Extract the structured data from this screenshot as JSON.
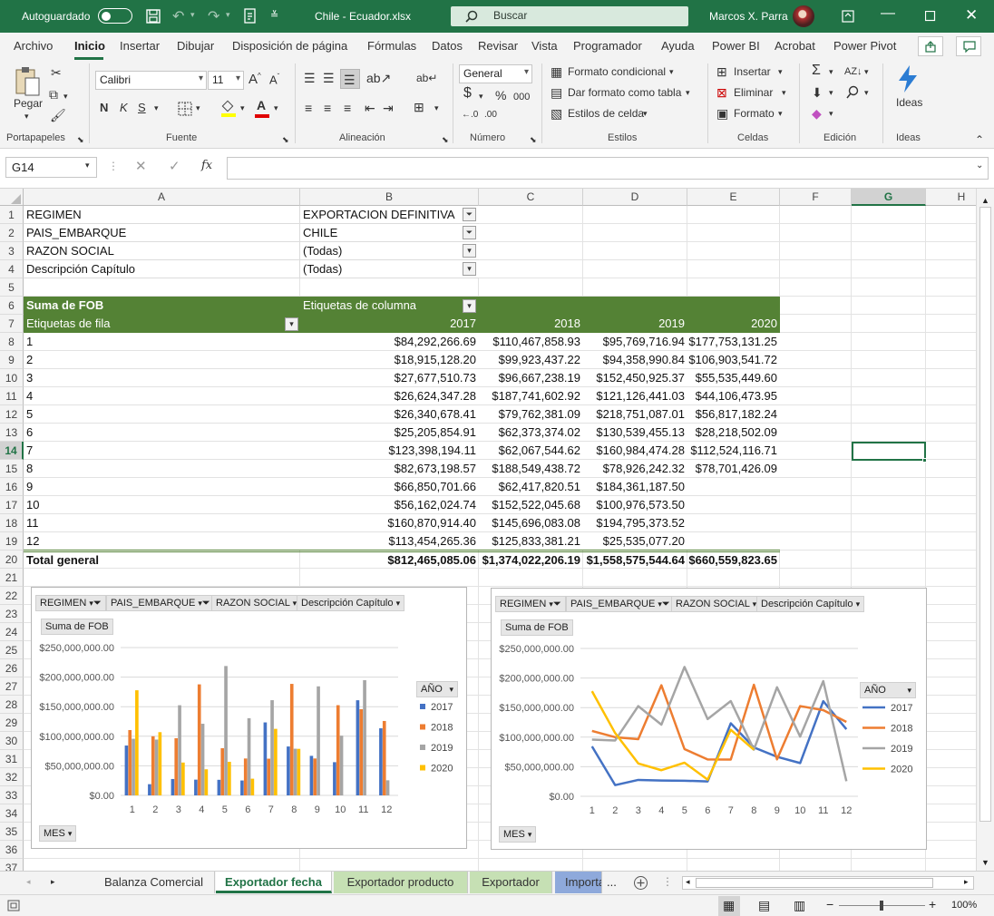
{
  "titlebar": {
    "autosave_label": "Autoguardado",
    "file_title": "Chile - Ecuador.xlsx",
    "search_placeholder": "Buscar",
    "user_name": "Marcos X. Parra"
  },
  "menu": [
    "Archivo",
    "Inicio",
    "Insertar",
    "Dibujar",
    "Disposición de página",
    "Fórmulas",
    "Datos",
    "Revisar",
    "Vista",
    "Programador",
    "Ayuda",
    "Power BI",
    "Acrobat",
    "Power Pivot"
  ],
  "ribbon": {
    "paste_label": "Pegar",
    "font_name": "Calibri",
    "font_size": "11",
    "number_format": "General",
    "conditional_format": "Formato condicional",
    "table_format": "Dar formato como tabla",
    "cell_styles": "Estilos de celda",
    "insert": "Insertar",
    "delete": "Eliminar",
    "format": "Formato",
    "ideas": "Ideas",
    "groups": [
      "Portapapeles",
      "Fuente",
      "Alineación",
      "Número",
      "Estilos",
      "Celdas",
      "Edición",
      "Ideas"
    ]
  },
  "formula_bar": {
    "name_box": "G14",
    "formula": ""
  },
  "columns": [
    "A",
    "B",
    "C",
    "D",
    "E",
    "F",
    "G",
    "H"
  ],
  "rows": [
    "1",
    "2",
    "3",
    "4",
    "5",
    "6",
    "7",
    "8",
    "9",
    "10",
    "11",
    "12",
    "13",
    "14",
    "15",
    "16",
    "17",
    "18",
    "19",
    "20",
    "21",
    "22",
    "23",
    "24",
    "25",
    "26",
    "27",
    "28",
    "29",
    "30",
    "31",
    "32",
    "33",
    "34",
    "35",
    "36",
    "37"
  ],
  "filters": [
    {
      "label": "REGIMEN",
      "value": "EXPORTACION DEFINITIVA"
    },
    {
      "label": "PAIS_EMBARQUE",
      "value": "CHILE"
    },
    {
      "label": "RAZON SOCIAL",
      "value": "(Todas)"
    },
    {
      "label": "Descripción Capítulo",
      "value": "(Todas)"
    }
  ],
  "pivot": {
    "value_header": "Suma de FOB",
    "col_labels": "Etiquetas de columna",
    "row_labels": "Etiquetas de fila",
    "years": [
      "2017",
      "2018",
      "2019",
      "2020"
    ],
    "rows": [
      {
        "label": "1",
        "values": [
          "$84,292,266.69",
          "$110,467,858.93",
          "$95,769,716.94",
          "$177,753,131.25"
        ]
      },
      {
        "label": "2",
        "values": [
          "$18,915,128.20",
          "$99,923,437.22",
          "$94,358,990.84",
          "$106,903,541.72"
        ]
      },
      {
        "label": "3",
        "values": [
          "$27,677,510.73",
          "$96,667,238.19",
          "$152,450,925.37",
          "$55,535,449.60"
        ]
      },
      {
        "label": "4",
        "values": [
          "$26,624,347.28",
          "$187,741,602.92",
          "$121,126,441.03",
          "$44,106,473.95"
        ]
      },
      {
        "label": "5",
        "values": [
          "$26,340,678.41",
          "$79,762,381.09",
          "$218,751,087.01",
          "$56,817,182.24"
        ]
      },
      {
        "label": "6",
        "values": [
          "$25,205,854.91",
          "$62,373,374.02",
          "$130,539,455.13",
          "$28,218,502.09"
        ]
      },
      {
        "label": "7",
        "values": [
          "$123,398,194.11",
          "$62,067,544.62",
          "$160,984,474.28",
          "$112,524,116.71"
        ]
      },
      {
        "label": "8",
        "values": [
          "$82,673,198.57",
          "$188,549,438.72",
          "$78,926,242.32",
          "$78,701,426.09"
        ]
      },
      {
        "label": "9",
        "values": [
          "$66,850,701.66",
          "$62,417,820.51",
          "$184,361,187.50",
          ""
        ]
      },
      {
        "label": "10",
        "values": [
          "$56,162,024.74",
          "$152,522,045.68",
          "$100,976,573.50",
          ""
        ]
      },
      {
        "label": "11",
        "values": [
          "$160,870,914.40",
          "$145,696,083.08",
          "$194,795,373.52",
          ""
        ]
      },
      {
        "label": "12",
        "values": [
          "$113,454,265.36",
          "$125,833,381.21",
          "$25,535,077.20",
          ""
        ]
      }
    ],
    "total_label": "Total general",
    "totals": [
      "$812,465,085.06",
      "$1,374,022,206.19",
      "$1,558,575,544.64",
      "$660,559,823.65"
    ]
  },
  "chart_fields": {
    "filters": [
      "REGIMEN",
      "PAIS_EMBARQUE",
      "RAZON SOCIAL",
      "Descripción Capítulo"
    ],
    "value_button": "Suma de FOB",
    "axis_button": "MES",
    "legend_title": "AÑO"
  },
  "chart_data": [
    {
      "type": "bar",
      "categories": [
        "1",
        "2",
        "3",
        "4",
        "5",
        "6",
        "7",
        "8",
        "9",
        "10",
        "11",
        "12"
      ],
      "ylim": [
        0,
        250000000
      ],
      "ytick_labels": [
        "$0.00",
        "$50,000,000.00",
        "$100,000,000.00",
        "$150,000,000.00",
        "$200,000,000.00",
        "$250,000,000.00"
      ],
      "legend": "right",
      "series": [
        {
          "name": "2017",
          "color": "#4472C4",
          "values": [
            84292266.69,
            18915128.2,
            27677510.73,
            26624347.28,
            26340678.41,
            25205854.91,
            123398194.11,
            82673198.57,
            66850701.66,
            56162024.74,
            160870914.4,
            113454265.36
          ]
        },
        {
          "name": "2018",
          "color": "#ED7D31",
          "values": [
            110467858.93,
            99923437.22,
            96667238.19,
            187741602.92,
            79762381.09,
            62373374.02,
            62067544.62,
            188549438.72,
            62417820.51,
            152522045.68,
            145696083.08,
            125833381.21
          ]
        },
        {
          "name": "2019",
          "color": "#A5A5A5",
          "values": [
            95769716.94,
            94358990.84,
            152450925.37,
            121126441.03,
            218751087.01,
            130539455.13,
            160984474.28,
            78926242.32,
            184361187.5,
            100976573.5,
            194795373.52,
            25535077.2
          ]
        },
        {
          "name": "2020",
          "color": "#FFC000",
          "values": [
            177753131.25,
            106903541.72,
            55535449.6,
            44106473.95,
            56817182.24,
            28218502.09,
            112524116.71,
            78701426.09,
            null,
            null,
            null,
            null
          ]
        }
      ]
    },
    {
      "type": "line",
      "categories": [
        "1",
        "2",
        "3",
        "4",
        "5",
        "6",
        "7",
        "8",
        "9",
        "10",
        "11",
        "12"
      ],
      "ylim": [
        0,
        250000000
      ],
      "ytick_labels": [
        "$0.00",
        "$50,000,000.00",
        "$100,000,000.00",
        "$150,000,000.00",
        "$200,000,000.00",
        "$250,000,000.00"
      ],
      "legend": "right",
      "series": [
        {
          "name": "2017",
          "color": "#4472C4",
          "values": [
            84292266.69,
            18915128.2,
            27677510.73,
            26624347.28,
            26340678.41,
            25205854.91,
            123398194.11,
            82673198.57,
            66850701.66,
            56162024.74,
            160870914.4,
            113454265.36
          ]
        },
        {
          "name": "2018",
          "color": "#ED7D31",
          "values": [
            110467858.93,
            99923437.22,
            96667238.19,
            187741602.92,
            79762381.09,
            62373374.02,
            62067544.62,
            188549438.72,
            62417820.51,
            152522045.68,
            145696083.08,
            125833381.21
          ]
        },
        {
          "name": "2019",
          "color": "#A5A5A5",
          "values": [
            95769716.94,
            94358990.84,
            152450925.37,
            121126441.03,
            218751087.01,
            130539455.13,
            160984474.28,
            78926242.32,
            184361187.5,
            100976573.5,
            194795373.52,
            25535077.2
          ]
        },
        {
          "name": "2020",
          "color": "#FFC000",
          "values": [
            177753131.25,
            106903541.72,
            55535449.6,
            44106473.95,
            56817182.24,
            28218502.09,
            112524116.71,
            78701426.09,
            null,
            null,
            null,
            null
          ]
        }
      ]
    }
  ],
  "sheet_tabs": [
    {
      "label": "Balanza Comercial",
      "color": "#f3f3f3"
    },
    {
      "label": "Exportador fecha",
      "color": "#ffffff"
    },
    {
      "label": "Exportador producto",
      "color": "#c6e0b4"
    },
    {
      "label": "Exportador",
      "color": "#c6e0b4"
    },
    {
      "label": "Importa",
      "color": "#8ea9db"
    }
  ],
  "status": {
    "zoom": "100%",
    "more_tabs": "..."
  }
}
